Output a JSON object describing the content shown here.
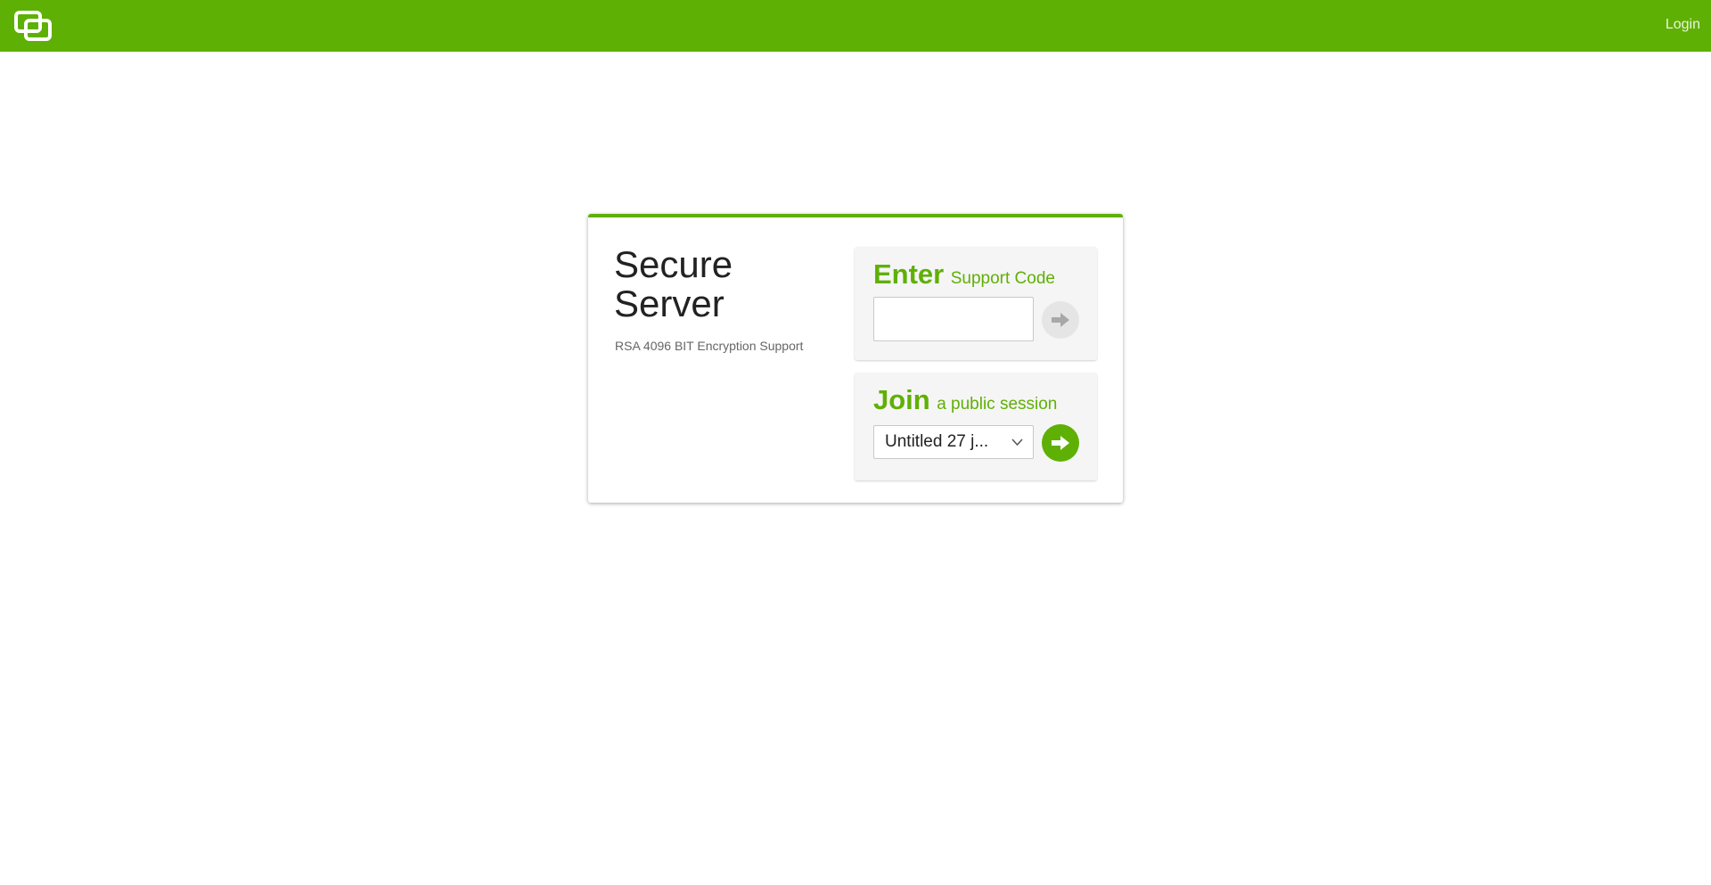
{
  "header": {
    "logo_icon": "screen-share-logo-icon",
    "login_label": "Login",
    "brand_color": "#5fb005"
  },
  "card": {
    "title": "Secure Server",
    "subtitle": "RSA 4096 BIT Encryption Support",
    "enter_panel": {
      "heading_big": "Enter",
      "heading_small": "Support Code",
      "input_value": "",
      "input_placeholder": "",
      "submit_icon": "arrow-right-icon"
    },
    "join_panel": {
      "heading_big": "Join",
      "heading_small": "a public session",
      "selected_session": "Untitled 27 j...",
      "submit_icon": "arrow-right-icon"
    }
  }
}
